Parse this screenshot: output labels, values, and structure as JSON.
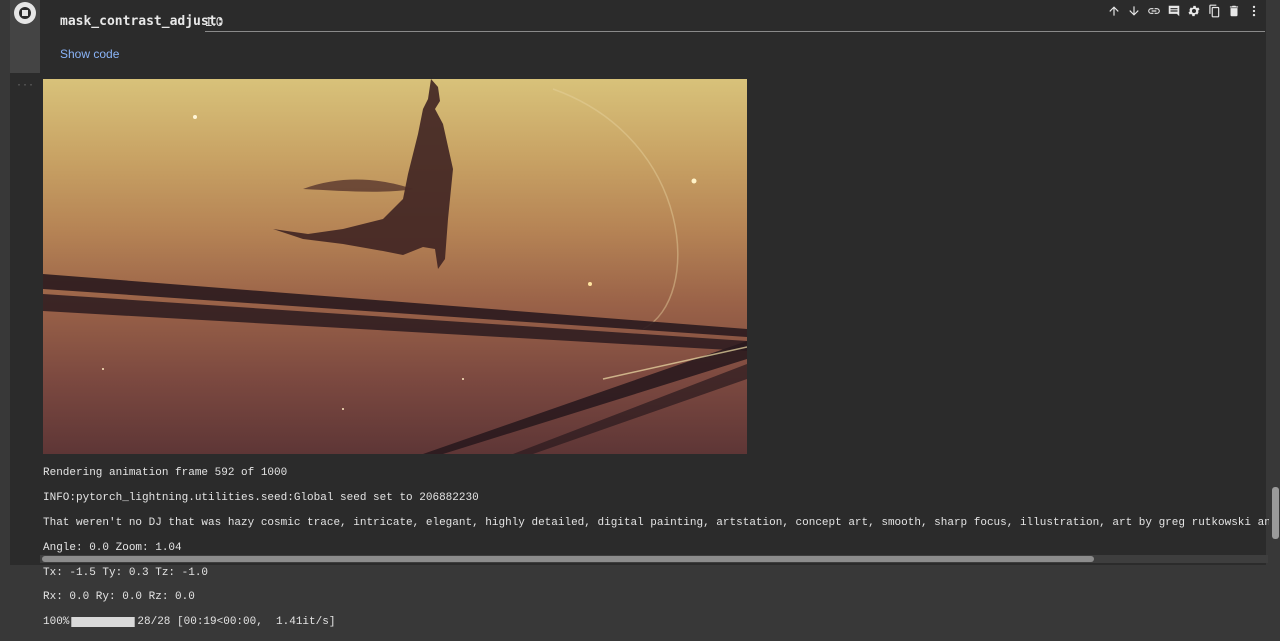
{
  "form": {
    "param_name": "mask_contrast_adjust:",
    "param_value": "1.0",
    "show_code": "Show code"
  },
  "console": {
    "line1": "Rendering animation frame 592 of 1000",
    "line2": "INFO:pytorch_lightning.utilities.seed:Global seed set to 206882230",
    "line3": "That weren't no DJ that was hazy cosmic trace, intricate, elegant, highly detailed, digital painting, artstation, concept art, smooth, sharp focus, illustration, art by greg rutkowski and alphonse mu",
    "line4": "Angle: 0.0 Zoom: 1.04",
    "line5": "Tx: -1.5 Ty: 0.3 Tz: -1.0",
    "line6": "Rx: 0.0 Ry: 0.0 Rz: 0.0",
    "progress_percent": "100%",
    "progress_stats": "28/28 [00:19<00:00,  1.41it/s]"
  },
  "toolbar_icons": [
    "arrow-up-icon",
    "arrow-down-icon",
    "link-icon",
    "comment-icon",
    "gear-icon",
    "mirror-icon",
    "trash-icon",
    "more-vert-icon"
  ],
  "colors": {
    "link": "#8ab4f8",
    "cell_bg": "#2b2b2b",
    "page_bg": "#383838"
  }
}
